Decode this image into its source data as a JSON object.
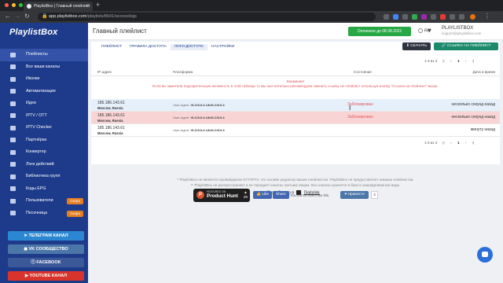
{
  "browser": {
    "tab_title": "PlaylistBox | Главный плейлист",
    "url_host": "app.playlistbox.com",
    "url_path": "/playlists/8641/accesslogs"
  },
  "sidebar": {
    "logo": "PlaylistBox",
    "items": [
      {
        "label": "Плейлисты",
        "active": true
      },
      {
        "label": "Все ваши каналы"
      },
      {
        "label": "Иконки"
      },
      {
        "label": "Автоматизация"
      },
      {
        "label": "Идеи"
      },
      {
        "label": "IPTV / OTT"
      },
      {
        "label": "IPTV Checker"
      },
      {
        "label": "Партнёрка"
      },
      {
        "label": "Конвертер"
      },
      {
        "label": "Логи действий"
      },
      {
        "label": "Библиотека групп"
      },
      {
        "label": "Коды EPG"
      },
      {
        "label": "Пользователи",
        "badge": "Скоро"
      },
      {
        "label": "Песочница",
        "badge": "Скоро"
      }
    ],
    "buttons": {
      "telegram": "ТЕЛЕГРАМ КАНАЛ",
      "vk": "VK СООБЩЕСТВО",
      "facebook": "FACEBOOK",
      "youtube": "YOUTUBE КАНАЛ"
    }
  },
  "header": {
    "title": "Главный плейлист",
    "paid": "Оплачено до 08.08.2021",
    "lang": "RU",
    "user_name": "PLAYLISTBOX",
    "user_email": "support@playlistbox.com"
  },
  "tabs": [
    "ПЛЕЙЛИСТ",
    "ПРАВИЛА ДОСТУПА",
    "ЛОГИ ДОСТУПА",
    "НАСТРОЙКИ"
  ],
  "actions": {
    "download": "СКАЧАТЬ",
    "link": "ССЫЛКА НА ПЛЕЙЛИСТ"
  },
  "pager": {
    "range": "1-3 из 3",
    "page": "1"
  },
  "table": {
    "headers": [
      "IP адрес",
      "Платформа",
      "Состояние",
      "Дата и время"
    ],
    "warning_title": "Внимание!",
    "warning_text": "Если вы заметили подозрительную активность в этой таблице то мы настоятельно рекомендуем сменить ссылку на плейлист используя кнопку \"Ссылка на плейлист\" выше.",
    "rows": [
      {
        "ip": "185.186.143.61",
        "location": "Moscow, Russia",
        "ua_label": "User-Agent:",
        "ua": "VLC/3.0.4 LibVLC/3.0.4",
        "status": "Заблокирован",
        "time": "несколько секунд назад",
        "bg": "#e6f0fb"
      },
      {
        "ip": "185.186.143.61",
        "location": "Moscow, Russia",
        "ua_label": "User-Agent:",
        "ua": "VLC/3.0.4 LibVLC/3.0.4",
        "status": "Заблокирован",
        "time": "несколько секунд назад",
        "bg": "#f9d4d4"
      },
      {
        "ip": "185.186.143.61",
        "location": "Moscow, Russia",
        "ua_label": "User-Agent:",
        "ua": "VLC/3.0.4 LibVLC/3.0.4",
        "status": "",
        "time": "минуту назад",
        "bg": "#ffffff"
      }
    ]
  },
  "footer": {
    "line1": "* PlaylistBox не является провайдером OTT/IPTV, это онлайн редактор ваших плейлистов. PlaylistBox не предоставляет никаких плейлистов.",
    "line2": "** PlaylistBox не распространяет и не передает каналы третьим лицам. Все каналы хранятся в базе в зашифрованном виде.",
    "dev_label": "Разработано в",
    "dev_name": "Digitalisk"
  },
  "social": {
    "ph_small": "FEATURED ON",
    "ph_big": "Product Hunt",
    "ph_count": "29",
    "fb_like": "Like",
    "fb_share": "Share",
    "fb_text": "You and 65 others like this.",
    "vk_like": "Нравится",
    "vk_count": "4"
  }
}
